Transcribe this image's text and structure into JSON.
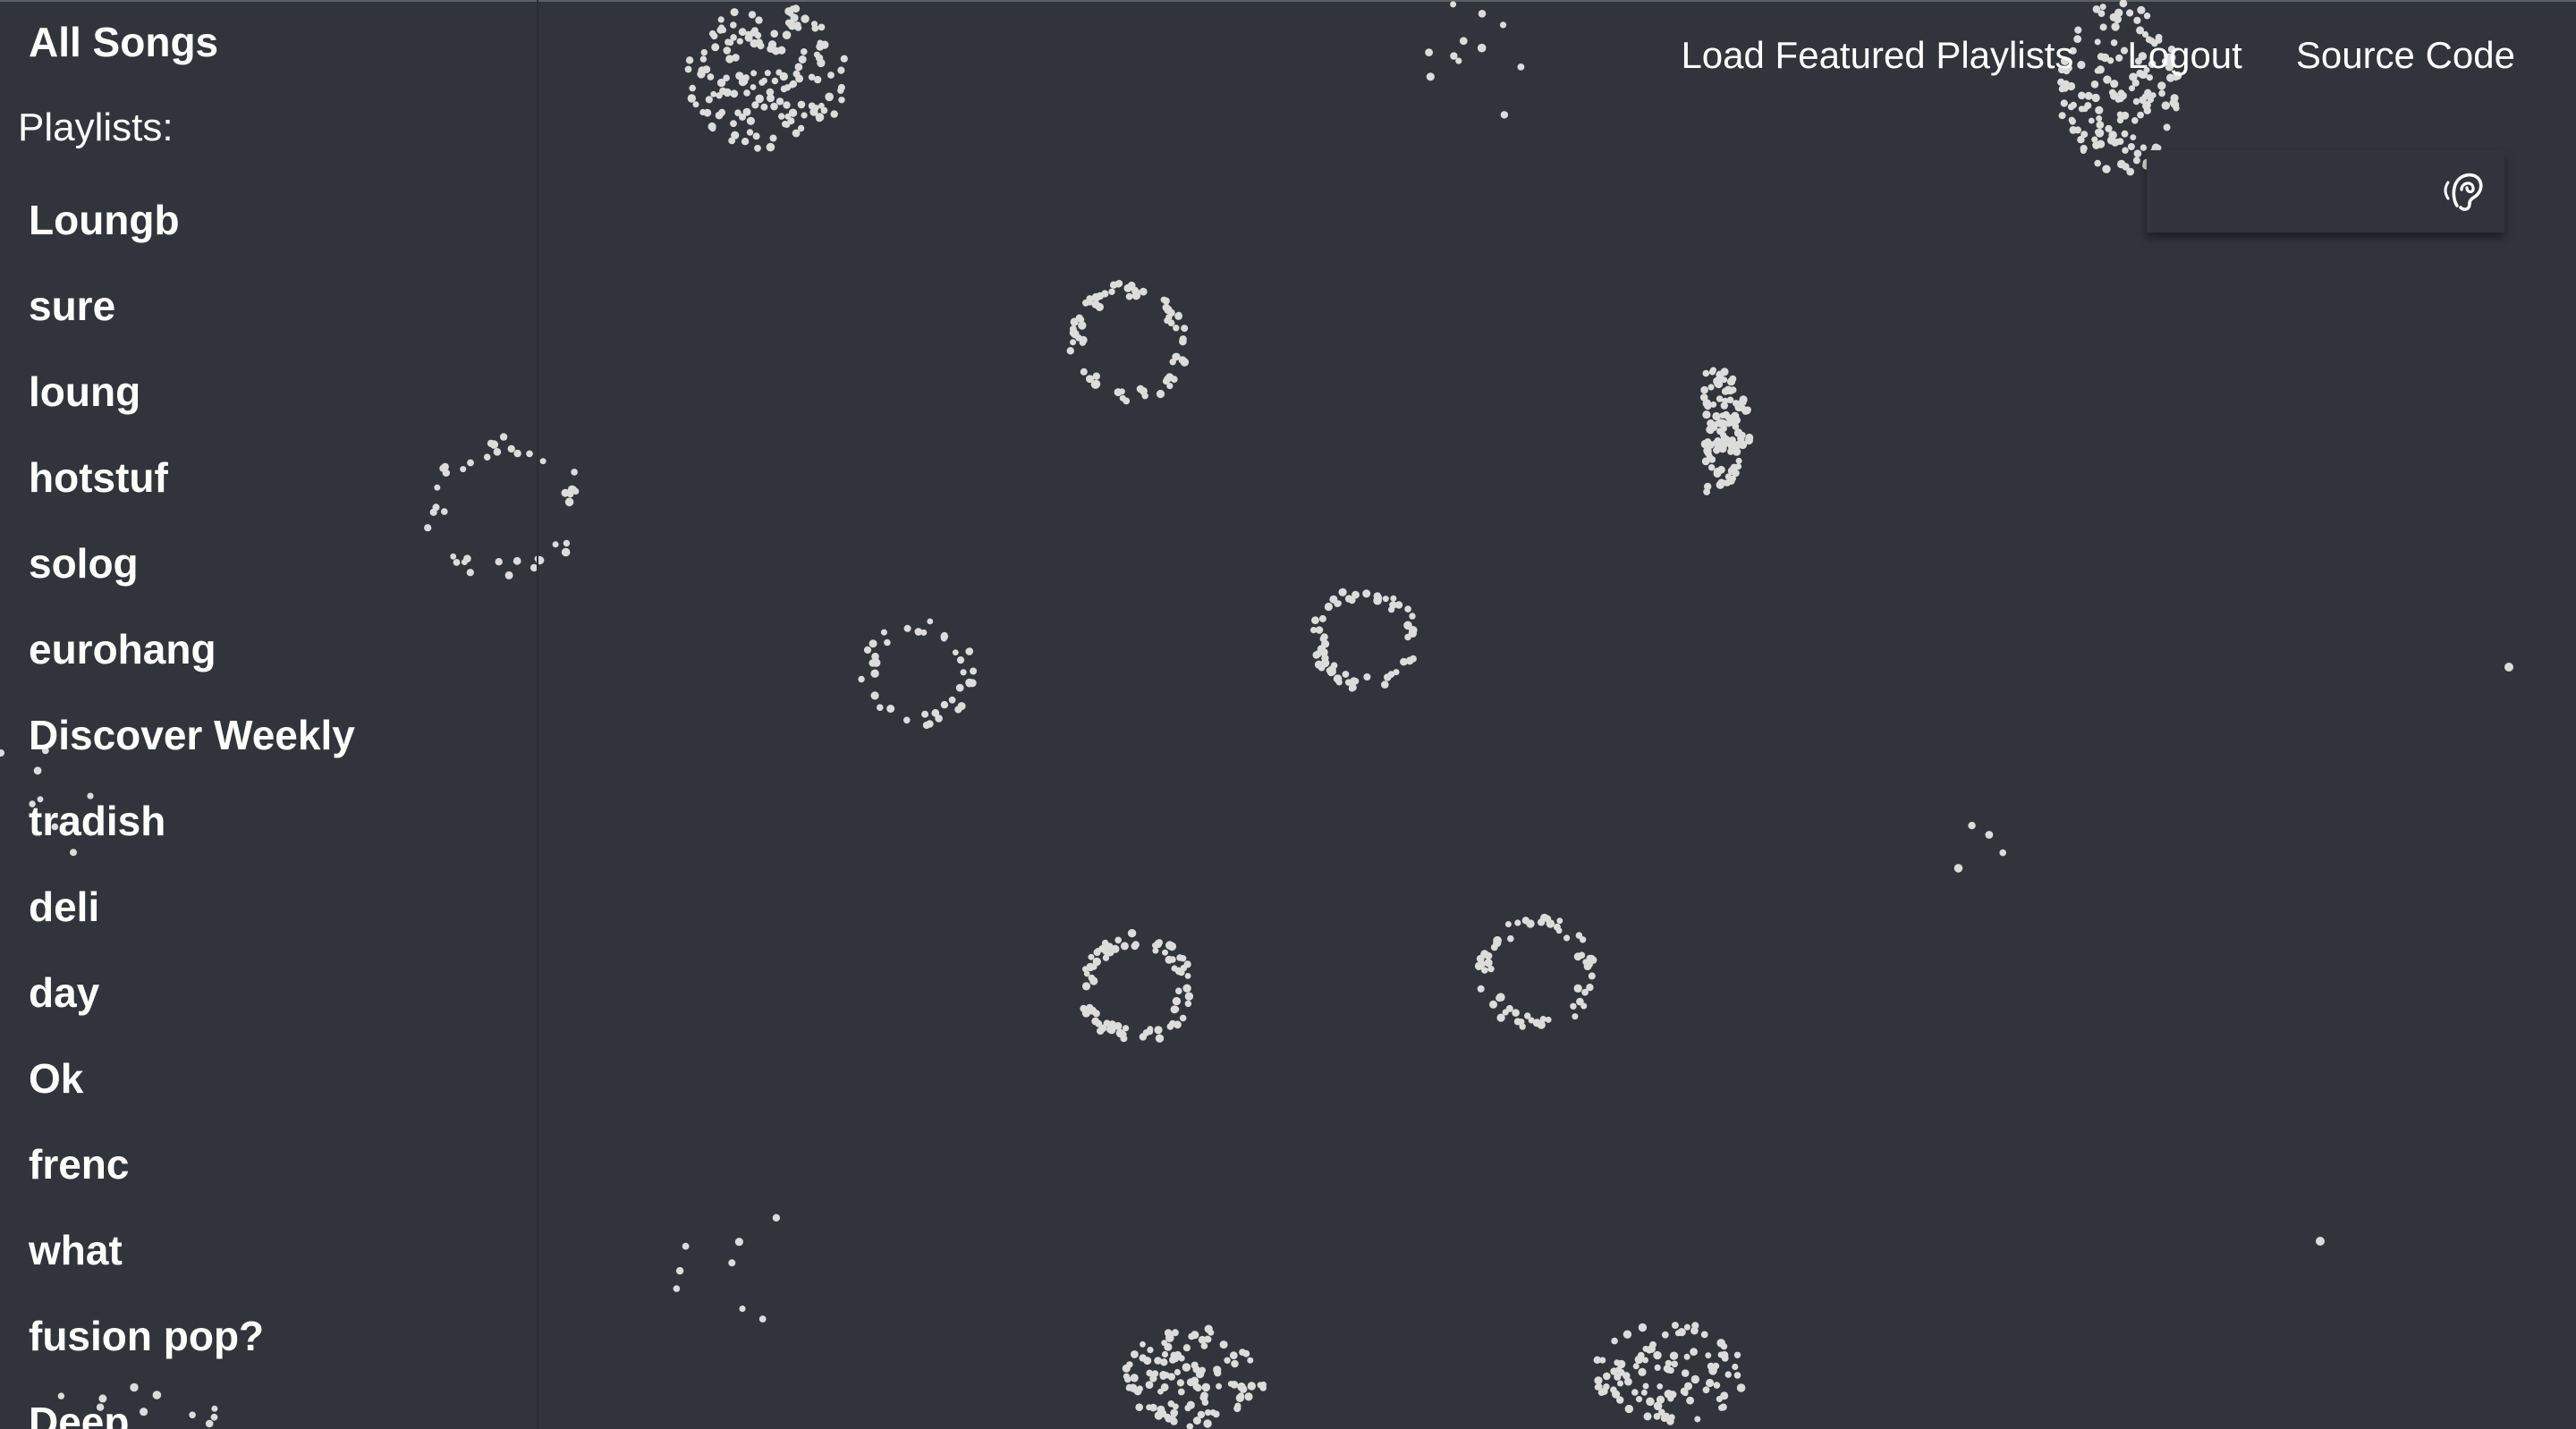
{
  "sidebar": {
    "all_songs": "All Songs",
    "playlists_label": "Playlists:",
    "playlists": [
      "Loungb",
      "sure",
      "loung",
      "hotstuf",
      "solog",
      "eurohang",
      "Discover Weekly",
      "tradish",
      "deli",
      "day",
      "Ok",
      "frenc",
      "what",
      "fusion pop?",
      "Deep"
    ]
  },
  "nav": {
    "load_featured": "Load Featured Playlists",
    "logout": "Logout",
    "source_code": "Source Code"
  },
  "search": {
    "value": "",
    "icon": "ear-icon"
  },
  "colors": {
    "background": "#31353b",
    "dot": "#dcdcdc",
    "text": "#ffffff"
  }
}
